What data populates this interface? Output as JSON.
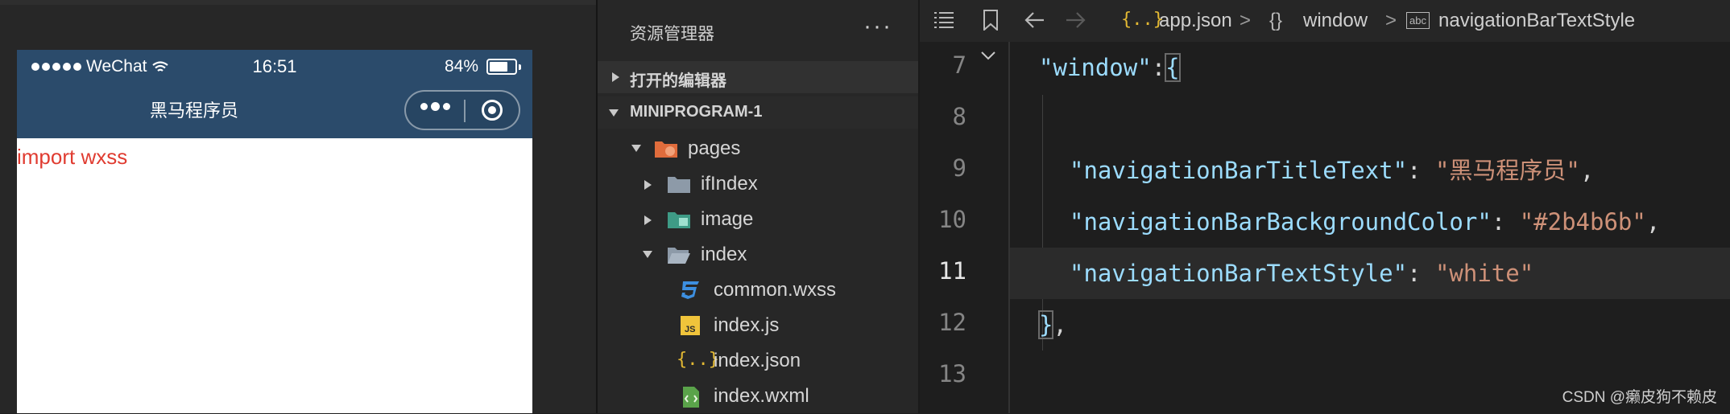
{
  "colors": {
    "nav_background": "#2b4b6b",
    "page_text": "#e03c31",
    "json_key": "#9cdcfe",
    "json_string": "#ce9178"
  },
  "simulator": {
    "status_bar": {
      "carrier": "WeChat",
      "time": "16:51",
      "battery_percent": "84%",
      "battery_level": 0.84,
      "signal_icon": "signal-dots-icon",
      "wifi_icon": "wifi-icon"
    },
    "nav_title": "黑马程序员",
    "capsule_icons": [
      "more-dots-icon",
      "target-circle-icon"
    ],
    "content_text": "import wxss"
  },
  "explorer": {
    "title": "资源管理器",
    "more_label": "···",
    "sections": [
      {
        "label": "打开的编辑器",
        "expanded": false
      },
      {
        "label": "MINIPROGRAM-1",
        "expanded": true
      }
    ],
    "tree": [
      {
        "label": "pages",
        "icon": "folder-pages-icon",
        "expanded": true
      },
      {
        "label": "ifIndex",
        "icon": "folder-icon",
        "expanded": false
      },
      {
        "label": "image",
        "icon": "folder-image-icon",
        "expanded": false
      },
      {
        "label": "index",
        "icon": "folder-open-icon",
        "expanded": true
      },
      {
        "label": "common.wxss",
        "icon": "css-file-icon"
      },
      {
        "label": "index.js",
        "icon": "js-file-icon"
      },
      {
        "label": "index.json",
        "icon": "json-file-icon"
      },
      {
        "label": "index.wxml",
        "icon": "wxml-file-icon"
      }
    ]
  },
  "editor": {
    "breadcrumb": {
      "file_icon": "{..}",
      "file": "app.json",
      "section_icon": "{}",
      "section": "window",
      "property_icon": "abc",
      "property": "navigationBarTextStyle",
      "separator": ">"
    },
    "lines": [
      {
        "number": "7",
        "key": "\"window\"",
        "colon": ":",
        "brace": "{"
      },
      {
        "number": "8"
      },
      {
        "number": "9",
        "key": "\"navigationBarTitleText\"",
        "colon": ": ",
        "value": "\"黑马程序员\"",
        "comma": ","
      },
      {
        "number": "10",
        "key": "\"navigationBarBackgroundColor\"",
        "colon": ": ",
        "value": "\"#2b4b6b\"",
        "comma": ","
      },
      {
        "number": "11",
        "key": "\"navigationBarTextStyle\"",
        "colon": ": ",
        "value": "\"white\""
      },
      {
        "number": "12",
        "close": "}",
        "comma": ","
      },
      {
        "number": "13"
      }
    ],
    "active_line": "11"
  },
  "watermark": "CSDN @癞皮狗不赖皮"
}
